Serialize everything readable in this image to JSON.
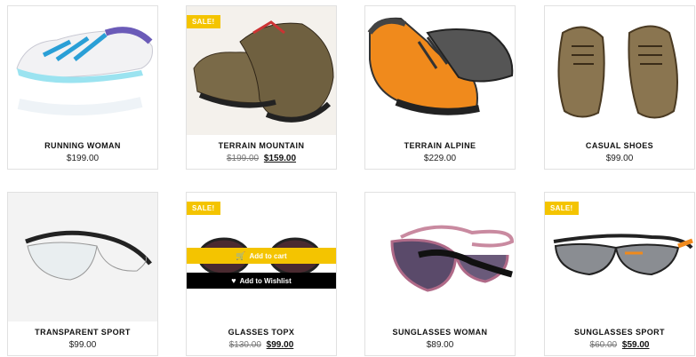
{
  "sale_badge": "SALE!",
  "overlay": {
    "add_to_cart": "Add to cart",
    "add_to_wishlist": "Add to Wishlist",
    "cart_icon": "cart-icon",
    "heart_icon": "heart-icon"
  },
  "colors": {
    "accent": "#f4c400",
    "dark": "#000000",
    "border": "#e1e1e1"
  },
  "products": [
    {
      "name": "RUNNING WOMAN",
      "price": "$199.00"
    },
    {
      "name": "TERRAIN MOUNTAIN",
      "old_price": "$199.00",
      "price": "$159.00",
      "sale": true
    },
    {
      "name": "TERRAIN ALPINE",
      "price": "$229.00"
    },
    {
      "name": "CASUAL SHOES",
      "price": "$99.00"
    },
    {
      "name": "TRANSPARENT SPORT",
      "price": "$99.00"
    },
    {
      "name": "GLASSES TOPX",
      "old_price": "$130.00",
      "price": "$99.00",
      "sale": true
    },
    {
      "name": "SUNGLASSES WOMAN",
      "price": "$89.00"
    },
    {
      "name": "SUNGLASSES SPORT",
      "old_price": "$60.00",
      "price": "$59.00",
      "sale": true
    }
  ]
}
